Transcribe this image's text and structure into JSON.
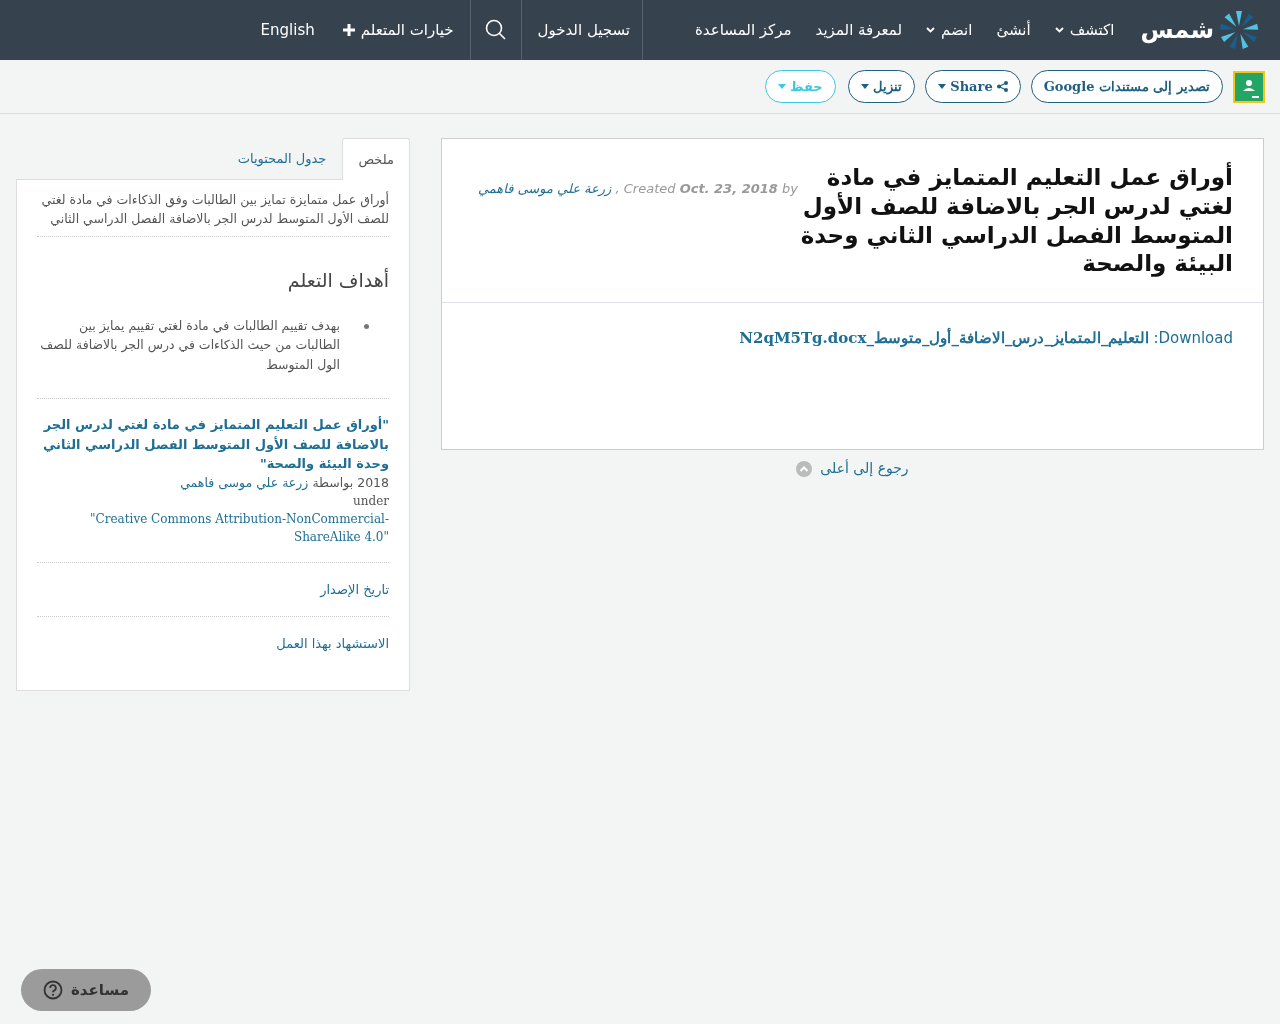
{
  "navbar": {
    "logo": "شمس",
    "items": [
      {
        "label": "اكتشف",
        "dropdown": true
      },
      {
        "label": "أنشئ",
        "dropdown": false
      },
      {
        "label": "انضم",
        "dropdown": true
      },
      {
        "label": "لمعرفة المزيد",
        "dropdown": false
      },
      {
        "label": "مركز المساعدة",
        "dropdown": false
      }
    ],
    "login": "تسجيل الدخول",
    "learner_options": "خيارات المتعلم",
    "language": "English"
  },
  "toolbar": {
    "buttons": [
      {
        "kind": "export",
        "label": "تصدير إلى مستندات Google",
        "caret": false
      },
      {
        "kind": "share",
        "label": "Share",
        "caret": true
      },
      {
        "kind": "download",
        "label": "تنزيل",
        "caret": true
      },
      {
        "kind": "save",
        "label": "حفظ",
        "caret": true
      }
    ]
  },
  "document": {
    "title": "أوراق عمل التعليم المتمايز في مادة لغتي لدرس الجر بالاضافة للصف الأول المتوسط الفصل الدراسي الثاني وحدة البيئة والصحة",
    "meta": {
      "author": "زرعة علي موسى فاهمي",
      "separator": ",",
      "created_label": "Created",
      "date": "Oct. 23, 2018",
      "by_label": "by"
    },
    "download_label": "Download:",
    "download_file": "التعليم_المتمايز_درس_الاضافة_أول_متوسط_N2qM5Tg.docx"
  },
  "back_to_top": "رجوع إلى أعلى",
  "sidebar": {
    "tabs": [
      {
        "label": "ملخص",
        "selected": true
      },
      {
        "label": "جدول المحتويات",
        "selected": false
      }
    ],
    "summary": "أوراق عمل متمايزة تمايز بين الطالبات وفق الذكاءات في مادة لغتي للصف الأول المتوسط لدرس الجر بالاضافة الفصل الدراسي الثاني",
    "objectives_heading": "أهداف التعلم",
    "objectives": [
      "بهدف تقييم الطالبات في مادة لغتي تقييم يمايز بين الطالبات من حيث الذكاءات في درس الجر بالاضافة للصف الول المتوسط"
    ],
    "citation": {
      "title": "\"أوراق عمل التعليم المتمايز في مادة لغتي لدرس الجر بالاضافة للصف الأول المتوسط الفصل الدراسي الثاني وحدة البيئة والصحة\"",
      "year_by": "2018 بواسطة",
      "author": "زرعة علي موسى فاهمي",
      "under": "under",
      "license": "\"Creative Commons Attribution-NonCommercial-ShareAlike 4.0\""
    },
    "links": [
      "تاريخ الإصدار",
      "الاستشهاد بهذا العمل"
    ]
  },
  "help_button": "مساعدة"
}
